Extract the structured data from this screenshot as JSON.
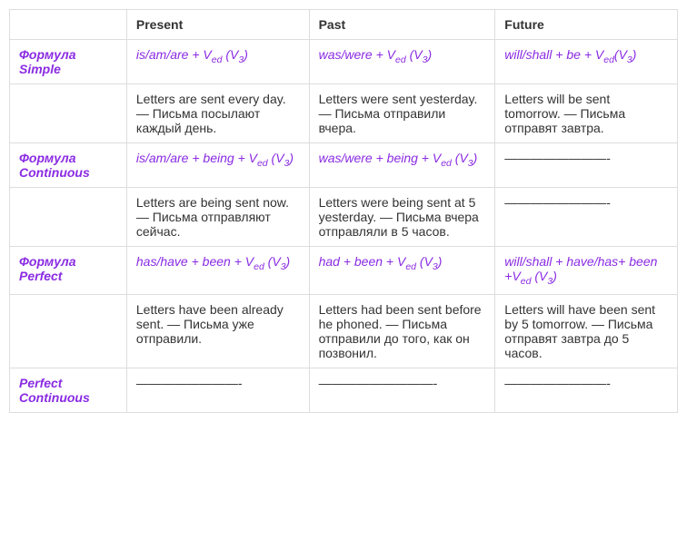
{
  "headers": {
    "present": "Present",
    "past": "Past",
    "future": "Future"
  },
  "rows": {
    "simple": {
      "label": "Формула Simple",
      "formula": {
        "present_a": "is/am/are + V",
        "present_b": "ed",
        "present_c": " (V",
        "present_d": "3",
        "present_e": ")",
        "past_a": "was/were + V",
        "past_b": "ed",
        "past_c": " (V",
        "past_d": "3",
        "past_e": ")",
        "future_a": "will/shall + be + V",
        "future_b": "ed",
        "future_c": "(V",
        "future_d": "3",
        "future_e": ")"
      },
      "example": {
        "present": " Letters are sent every day. — Письма посылают каждый день.",
        "past": " Letters were sent yesterday. — Письма отправили вчера.",
        "future": " Letters will be sent tomorrow. — Письма отправят завтра."
      }
    },
    "continuous": {
      "label": "Формула Continuous",
      "formula": {
        "present_a": "is/am/are + being + V",
        "present_b": "ed",
        "present_c": " (V",
        "present_d": "3",
        "present_e": ")",
        "past_a": "was/were + being + V",
        "past_b": "ed",
        "past_c": " (V",
        "past_d": "3",
        "past_e": ")",
        "future": "————————-"
      },
      "example": {
        "present": " Letters are being sent now. — Письма отправляют сейчас.",
        "past": " Letters were being sent at 5 yesterday. — Письма вчера отправляли в 5 часов.",
        "future": "————————-"
      }
    },
    "perfect": {
      "label": "Формула Perfect",
      "formula": {
        "present_a": "has/have + been + V",
        "present_b": "ed",
        "present_c": " (V",
        "present_d": "3",
        "present_e": ")",
        "past_a": "had + been + V",
        "past_b": "ed",
        "past_c": " (V",
        "past_d": "3",
        "past_e": ")",
        "future_a": " will/shall + have/has+ been +V",
        "future_b": "ed",
        "future_c": " (V",
        "future_d": "3",
        "future_e": ")"
      },
      "example": {
        "present": "  Letters have been already sent. — Письма уже отправили.",
        "past": " Letters had been sent before he phoned. — Письма отправили до того, как он позвонил.",
        "future": "  Letters will have been sent by 5 tomorrow. — Письма отправят завтра до 5 часов."
      }
    },
    "perfect_continuous": {
      "label": "Perfect Continuous",
      "example": {
        "present": "————————-",
        "past": "—————————-",
        "future": "————————-"
      }
    }
  }
}
